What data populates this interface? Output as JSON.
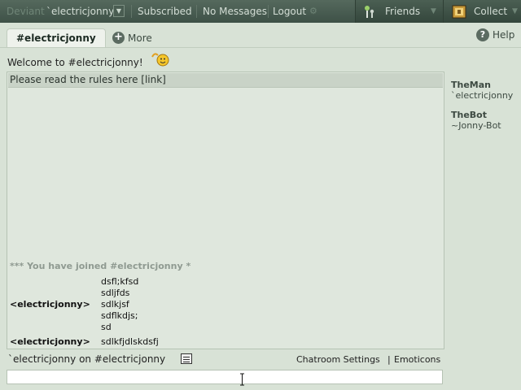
{
  "topbar": {
    "deviant_label": "Deviant",
    "username": "`electricjonny",
    "subscribed": "Subscribed",
    "messages": "No Messages",
    "logout": "Logout",
    "friends": "Friends",
    "collect": "Collect"
  },
  "tabs": {
    "active": "#electricjonny",
    "more": "More",
    "help": "Help"
  },
  "welcome": "Welcome to #electricjonny!",
  "topic": "Please read the rules here [link]",
  "chat": {
    "joined": "*** You have joined #electricjonny *",
    "messages": [
      {
        "nick": "<electricjonny>",
        "lines": [
          "dsfl;kfsd",
          "sdljfds",
          "sdlkjsf",
          "sdflkdjs;",
          "sd"
        ]
      },
      {
        "nick": "<electricjonny>",
        "lines": [
          "sdlkfjdlskdsfj"
        ]
      }
    ]
  },
  "users": [
    {
      "group": "TheMan",
      "name": "`electricjonny"
    },
    {
      "group": "TheBot",
      "name": "~Jonny-Bot"
    }
  ],
  "bottom": {
    "status": "`electricjonny on #electricjonny",
    "settings": "Chatroom Settings",
    "separator": "|",
    "emoticons": "Emoticons",
    "input_value": ""
  },
  "colors": {
    "topbar": "#4a5d52",
    "background": "#d8e2d6",
    "chat_background": "#dfe7dd",
    "joined_text": "#8f9a91"
  },
  "icons": [
    "dropdown-arrow-icon",
    "friends-icon",
    "collect-icon",
    "plus-icon",
    "help-icon",
    "smiley-icon",
    "list-icon",
    "text-cursor-icon"
  ]
}
